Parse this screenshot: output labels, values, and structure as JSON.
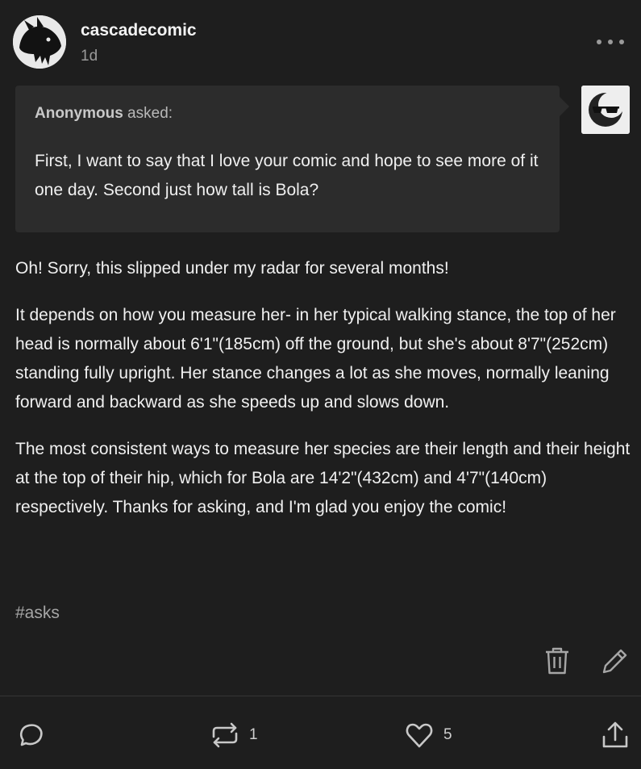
{
  "post": {
    "username": "cascadecomic",
    "timestamp": "1d",
    "ask": {
      "asker_name": "Anonymous",
      "asker_suffix": " asked:",
      "question": "First, I want to say that I love your comic and hope to see more of it one day. Second just how tall is Bola?"
    },
    "answer_paragraphs": [
      "Oh! Sorry, this slipped under my radar for several months!",
      "It depends on how you measure her- in her typical walking stance, the top of her head is normally about 6'1\"(185cm) off the ground, but she's about 8'7\"(252cm) standing fully upright. Her stance changes a lot as she moves, normally leaning forward and backward as she speeds up and slows down.",
      "The most consistent ways to measure her species are their length and their height at the top of their hip, which for Bola are 14'2\"(432cm) and 4'7\"(140cm) respectively. Thanks for asking, and I'm glad you enjoy the comic!"
    ],
    "tags": [
      "#asks"
    ]
  },
  "actions": {
    "reblog_count": "1",
    "like_count": "5"
  },
  "icons": {
    "more": "more-horizontal-icon",
    "delete": "trash-icon",
    "edit": "pencil-icon",
    "reply": "speech-bubble-icon",
    "reblog": "reblog-icon",
    "like": "heart-icon",
    "share": "share-upload-icon"
  }
}
